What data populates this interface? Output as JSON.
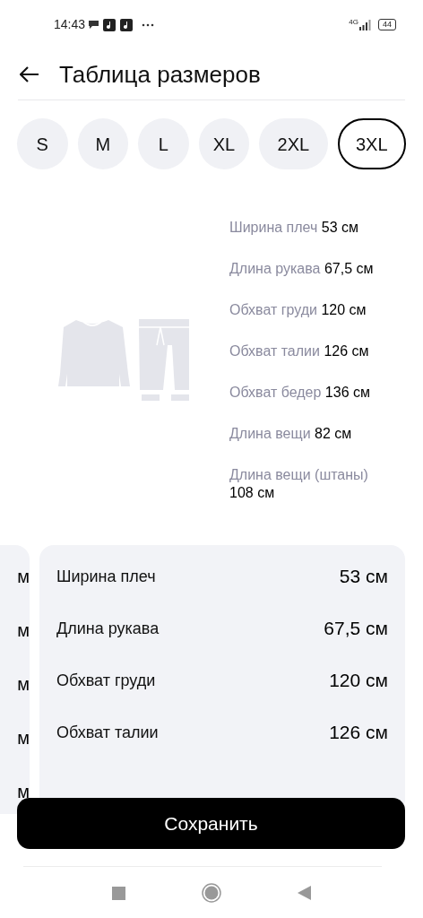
{
  "status_bar": {
    "time": "14:43",
    "network": "4G",
    "battery": "44"
  },
  "header": {
    "title": "Таблица размеров"
  },
  "sizes": [
    {
      "label": "S",
      "selected": false
    },
    {
      "label": "M",
      "selected": false
    },
    {
      "label": "L",
      "selected": false
    },
    {
      "label": "XL",
      "selected": false
    },
    {
      "label": "2XL",
      "selected": false
    },
    {
      "label": "3XL",
      "selected": true
    }
  ],
  "measurements": [
    {
      "label": "Ширина плеч",
      "value": "53 см"
    },
    {
      "label": "Длина рукава",
      "value": "67,5 см"
    },
    {
      "label": "Обхват груди",
      "value": "120 см"
    },
    {
      "label": "Обхват талии",
      "value": "126 см"
    },
    {
      "label": "Обхват бедер",
      "value": "136 см"
    },
    {
      "label": "Длина вещи",
      "value": "82 см"
    },
    {
      "label": "Длина вещи (штаны)",
      "value": "108 см"
    }
  ],
  "previous_card": {
    "values": [
      "м",
      "м",
      "м",
      "м",
      "м"
    ]
  },
  "current_card": {
    "rows": [
      {
        "label": "Ширина плеч",
        "value": "53 см"
      },
      {
        "label": "Длина рукава",
        "value": "67,5 см"
      },
      {
        "label": "Обхват груди",
        "value": "120 см"
      },
      {
        "label": "Обхват талии",
        "value": "126 см"
      }
    ]
  },
  "save_button": {
    "label": "Сохранить"
  }
}
